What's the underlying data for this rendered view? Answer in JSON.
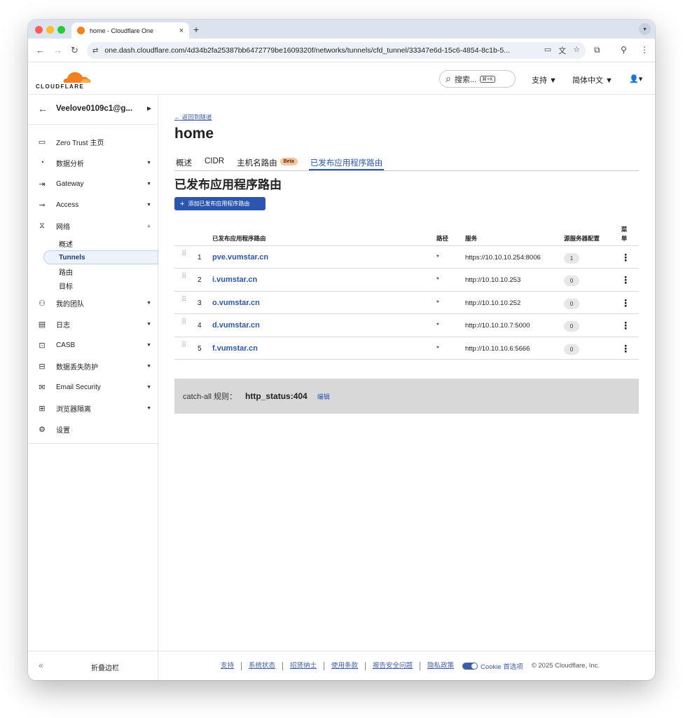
{
  "browser": {
    "tab_title": "home - Cloudflare One",
    "new_tab": "+",
    "url": "one.dash.cloudflare.com/4d34b2fa25387bb6472779be1609320f/networks/tunnels/cfd_tunnel/33347e6d-15c6-4854-8c1b-5..."
  },
  "header": {
    "logo_text": "CLOUDFLARE",
    "search_label": "搜索...",
    "search_shortcut": "⌘+K",
    "support": "支持 ▼",
    "language": "简体中文 ▼",
    "user": "▲▼"
  },
  "sidebar": {
    "account": "Veelove0109c1@g...",
    "items": [
      {
        "label": "Zero Trust 主页",
        "icon": "home-icon"
      },
      {
        "label": "数据分析",
        "icon": "analytics-icon"
      },
      {
        "label": "Gateway",
        "icon": "gateway-icon"
      },
      {
        "label": "Access",
        "icon": "access-icon"
      },
      {
        "label": "网络",
        "icon": "network-icon"
      },
      {
        "label": "我的团队",
        "icon": "team-icon"
      },
      {
        "label": "日志",
        "icon": "logs-icon"
      },
      {
        "label": "CASB",
        "icon": "casb-icon"
      },
      {
        "label": "数据丢失防护",
        "icon": "dlp-icon"
      },
      {
        "label": "Email Security",
        "icon": "email-icon"
      },
      {
        "label": "浏览器隔离",
        "icon": "browser-icon"
      },
      {
        "label": "设置",
        "icon": "settings-icon"
      }
    ],
    "network_sub": [
      "概述",
      "Tunnels",
      "路由",
      "目标"
    ],
    "collapse": "折叠边栏"
  },
  "main": {
    "back_link": "← 返回到隧道",
    "title": "home",
    "tabs": [
      "概述",
      "CIDR",
      "主机名路由",
      "已发布应用程序路由"
    ],
    "beta": "Beta",
    "section_title": "已发布应用程序路由",
    "add_button": "添加已发布应用程序路由",
    "table": {
      "headers": [
        "已发布应用程序路由",
        "路径",
        "服务",
        "源服务器配置",
        "菜单"
      ],
      "rows": [
        {
          "num": "1",
          "host": "pve.vumstar.cn",
          "path": "*",
          "service": "https://10.10.10.254:8006",
          "origin": "1"
        },
        {
          "num": "2",
          "host": "i.vumstar.cn",
          "path": "*",
          "service": "http://10.10.10.253",
          "origin": "0"
        },
        {
          "num": "3",
          "host": "o.vumstar.cn",
          "path": "*",
          "service": "http://10.10.10.252",
          "origin": "0"
        },
        {
          "num": "4",
          "host": "d.vumstar.cn",
          "path": "*",
          "service": "http://10.10.10.7:5000",
          "origin": "0"
        },
        {
          "num": "5",
          "host": "f.vumstar.cn",
          "path": "*",
          "service": "http://10.10.10.6:5666",
          "origin": "0"
        }
      ]
    },
    "catchall_label": "catch-all 规则：",
    "catchall_value": "http_status:404",
    "catchall_edit": "编辑"
  },
  "footer": {
    "links": [
      "支持",
      "系统状态",
      "招贤纳士",
      "使用条款",
      "报告安全问题",
      "隐私政策"
    ],
    "cookie": "Cookie 首选项",
    "copyright": "© 2025 Cloudflare, Inc."
  },
  "colors": {
    "accent": "#2c57b2",
    "brand": "#f38020"
  }
}
